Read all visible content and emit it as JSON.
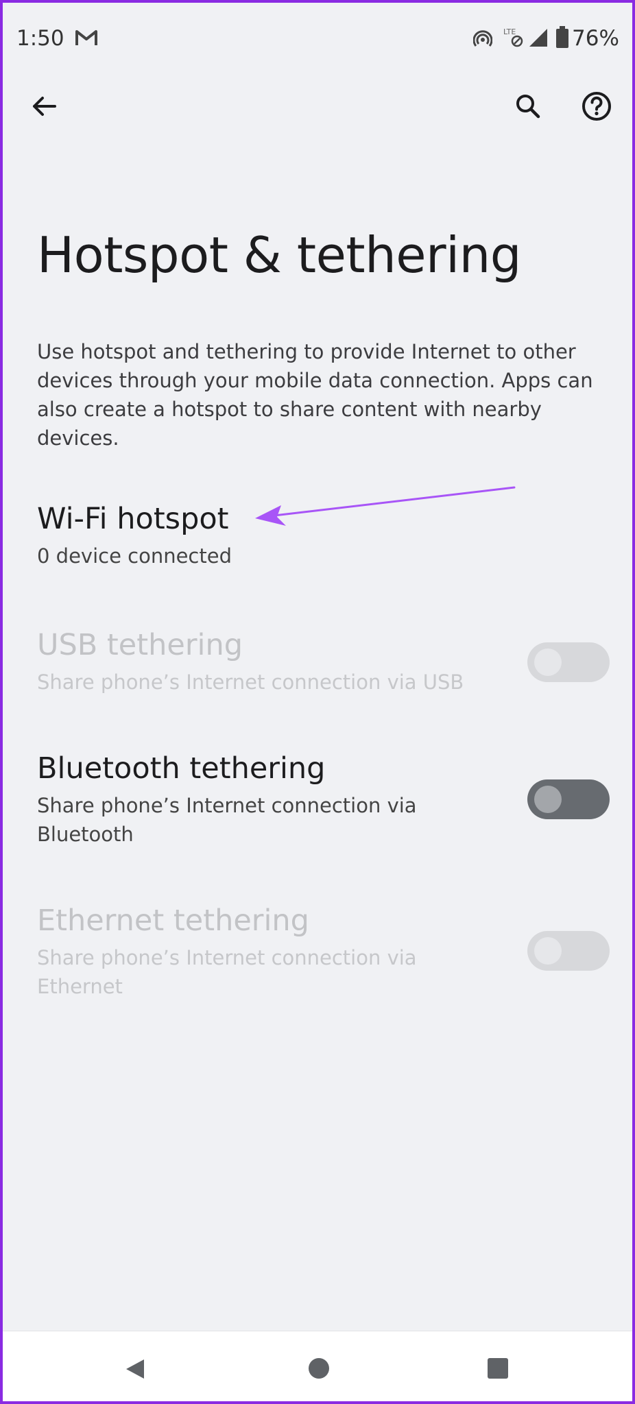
{
  "status_bar": {
    "time": "1:50",
    "battery": "76%",
    "icons": [
      "gmail-icon",
      "hotspot-icon",
      "lte-icon",
      "signal-icon",
      "battery-icon"
    ]
  },
  "toolbar": {
    "icons": [
      "back-arrow-icon",
      "search-icon",
      "help-icon"
    ]
  },
  "page": {
    "title": "Hotspot & tethering",
    "description": "Use hotspot and tethering to provide Internet to other devices through your mobile data connection. Apps can also create a hotspot to share content with nearby devices."
  },
  "items": {
    "wifi": {
      "title": "Wi-Fi hotspot",
      "subtitle": "0 device connected"
    },
    "usb": {
      "title": "USB tethering",
      "subtitle": "Share phone’s Internet connection via USB",
      "enabled": false,
      "toggle_on": false
    },
    "bluetooth": {
      "title": "Bluetooth tethering",
      "subtitle": "Share phone’s Internet connection via Bluetooth",
      "enabled": true,
      "toggle_on": false
    },
    "ethernet": {
      "title": "Ethernet tethering",
      "subtitle": "Share phone’s Internet connection via Ethernet",
      "enabled": false,
      "toggle_on": false
    }
  },
  "annotation": {
    "arrow_color": "#a855f7"
  },
  "nav_bar": {
    "icons": [
      "nav-back-icon",
      "nav-home-icon",
      "nav-recents-icon"
    ]
  },
  "colors": {
    "background": "#f0f1f4",
    "frame": "#8a2be2",
    "toggle_off_active": "#676b70",
    "disabled_text": "#c2c3c6"
  }
}
